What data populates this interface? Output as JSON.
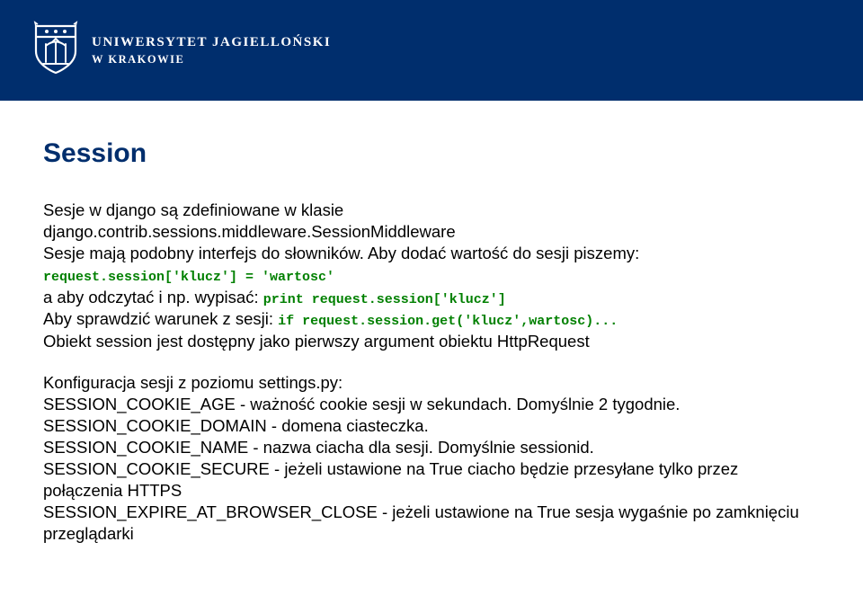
{
  "header": {
    "uni_line1": "UNIWERSYTET JAGIELLOŃSKI",
    "uni_line2": "W KRAKOWIE"
  },
  "title": "Session",
  "p1_l1": "Sesje w django są zdefiniowane w klasie",
  "p1_l2": "django.contrib.sessions.middleware.SessionMiddleware",
  "p1_l3": "Sesje mają podobny interfejs do słowników. Aby dodać wartość do sesji piszemy:",
  "code1": "request.session['klucz'] = 'wartosc'",
  "p2_a": "a aby odczytać i np. wypisać: ",
  "code2": "print request.session['klucz']",
  "p3_a": "Aby sprawdzić warunek z sesji: ",
  "code3": "if request.session.get('klucz',wartosc)...",
  "p4": "Obiekt session jest dostępny jako pierwszy argument obiektu HttpRequest",
  "cfg_title": "Konfiguracja sesji z poziomu settings.py:",
  "cfg1": "SESSION_COOKIE_AGE - ważność cookie sesji w sekundach. Domyślnie 2 tygodnie.",
  "cfg2": "SESSION_COOKIE_DOMAIN - domena ciasteczka.",
  "cfg3": "SESSION_COOKIE_NAME - nazwa ciacha dla sesji. Domyślnie sessionid.",
  "cfg4": "SESSION_COOKIE_SECURE - jeżeli ustawione na True ciacho będzie przesyłane tylko przez połączenia HTTPS",
  "cfg5": "SESSION_EXPIRE_AT_BROWSER_CLOSE - jeżeli ustawione na True sesja wygaśnie po zamknięciu przeglądarki"
}
